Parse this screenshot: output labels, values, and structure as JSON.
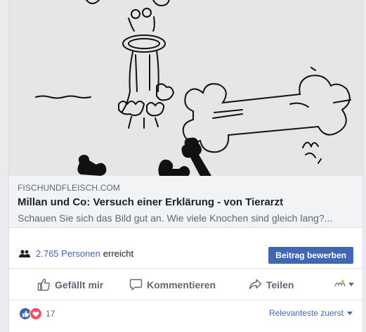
{
  "link": {
    "domain": "FISCHUNDFLEISCH.COM",
    "title": "Millan und Co: Versuch einer Erklärung - von Tierarzt",
    "description": "Schauen Sie sich das Bild gut an. Wie viele Knochen sind gleich lang?..."
  },
  "reach": {
    "count": "2.765 Personen",
    "suffix": "erreicht",
    "icon": "people-icon"
  },
  "boost_button": "Beitrag bewerben",
  "actions": {
    "like": "Gefällt mir",
    "comment": "Kommentieren",
    "share": "Teilen"
  },
  "reactions": {
    "count": "17",
    "icons": [
      "like-reaction-icon",
      "love-reaction-icon"
    ],
    "sort_label": "Relevanteste zuerst"
  },
  "colors": {
    "accent": "#4267b2",
    "like": "#4267b2",
    "love": "#f25268",
    "muted": "#606770"
  }
}
